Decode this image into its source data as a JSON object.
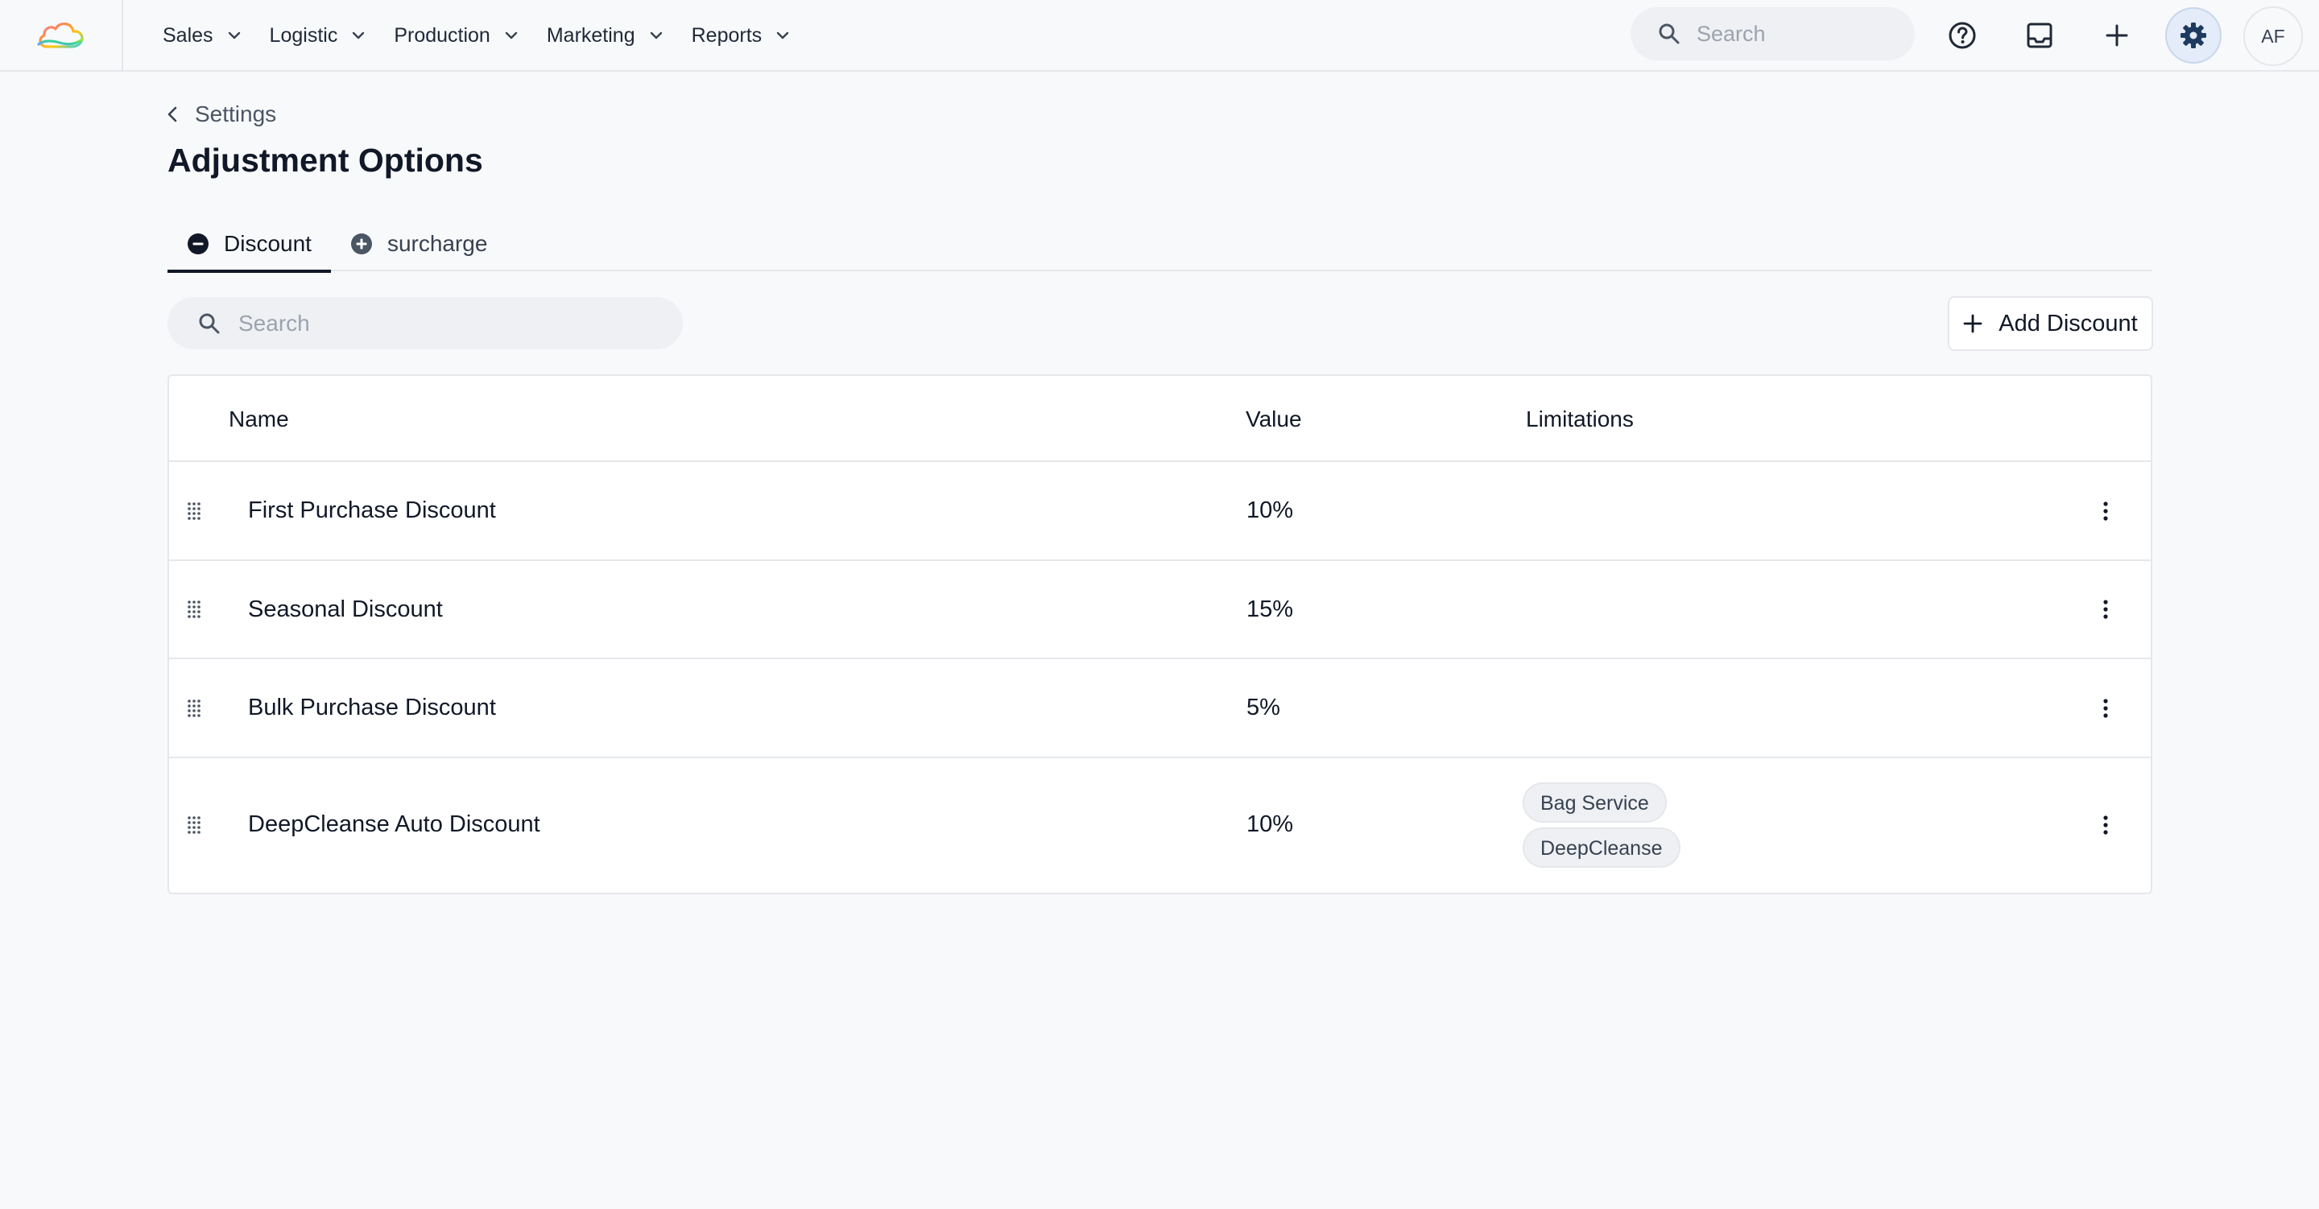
{
  "nav": {
    "items": [
      {
        "label": "Sales"
      },
      {
        "label": "Logistic"
      },
      {
        "label": "Production"
      },
      {
        "label": "Marketing"
      },
      {
        "label": "Reports"
      }
    ],
    "search_placeholder": "Search",
    "avatar_initials": "AF"
  },
  "page": {
    "breadcrumb": "Settings",
    "title": "Adjustment Options"
  },
  "tabs": [
    {
      "label": "Discount",
      "icon": "minus-circle-icon",
      "active": true
    },
    {
      "label": "surcharge",
      "icon": "plus-circle-icon",
      "active": false
    }
  ],
  "toolbar": {
    "search_placeholder": "Search",
    "add_label": "Add Discount"
  },
  "table": {
    "columns": [
      "Name",
      "Value",
      "Limitations"
    ],
    "rows": [
      {
        "name": "First Purchase Discount",
        "value": "10%",
        "limitations": []
      },
      {
        "name": "Seasonal Discount",
        "value": "15%",
        "limitations": []
      },
      {
        "name": "Bulk Purchase Discount",
        "value": "5%",
        "limitations": []
      },
      {
        "name": "DeepCleanse Auto Discount",
        "value": "10%",
        "limitations": [
          "Bag Service",
          "DeepCleanse"
        ]
      }
    ]
  },
  "colors": {
    "accent": "#1e3a5f",
    "background": "#f8f9fb",
    "border": "#e5e7eb"
  }
}
